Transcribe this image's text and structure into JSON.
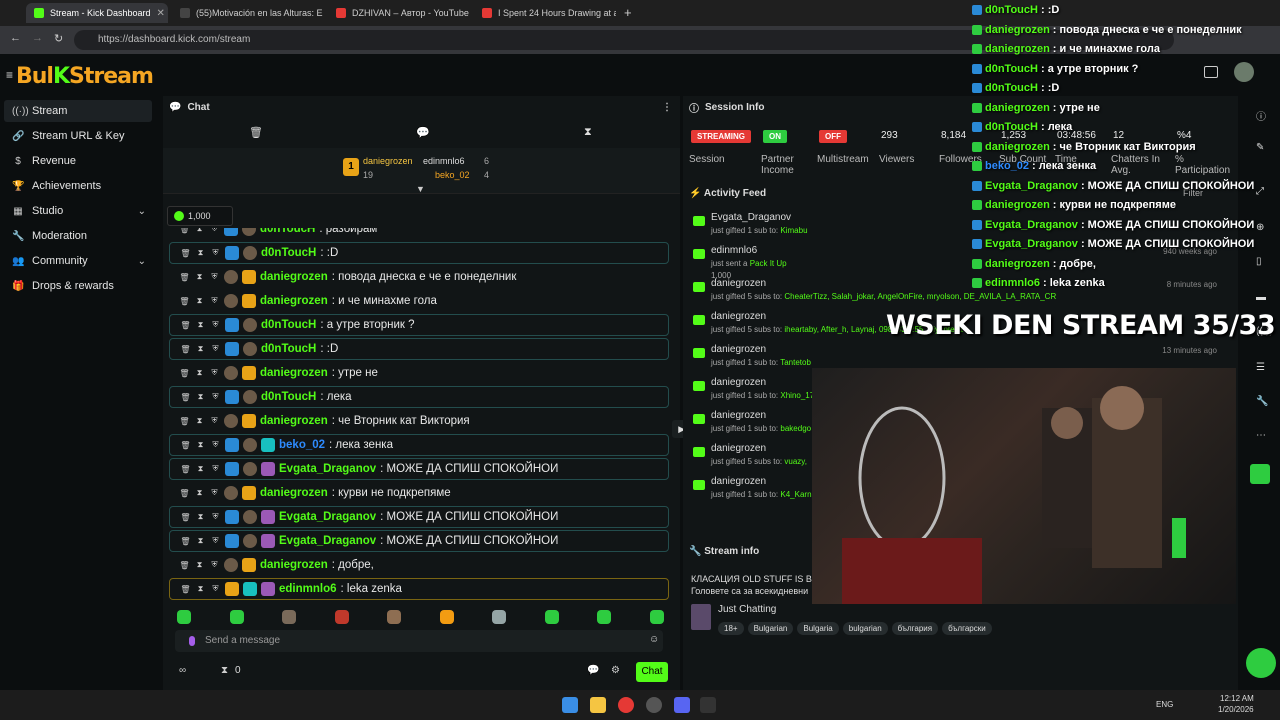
{
  "browser": {
    "tabs": [
      {
        "title": "Stream - Kick Dashboard",
        "color": "#53fc18"
      },
      {
        "title": "(55)Motivación en las Alturas: E",
        "color": "#444"
      },
      {
        "title": "DZHIVAN – Автор - YouTube",
        "color": "#e53935"
      },
      {
        "title": "I Spent 24 Hours Drawing at an",
        "color": "#e53935"
      }
    ],
    "url": "https://dashboard.kick.com/stream"
  },
  "sidebar": {
    "items": [
      {
        "label": "Stream",
        "icon": "((·))"
      },
      {
        "label": "Stream URL & Key",
        "icon": "🔗"
      },
      {
        "label": "Revenue",
        "icon": "$"
      },
      {
        "label": "Achievements",
        "icon": "🏆"
      },
      {
        "label": "Studio",
        "icon": "▦"
      },
      {
        "label": "Moderation",
        "icon": "🔧"
      },
      {
        "label": "Community",
        "icon": "👥"
      },
      {
        "label": "Drops & rewards",
        "icon": "🎁"
      }
    ]
  },
  "chat": {
    "title": "Chat",
    "leaderboard": [
      {
        "name": "daniegrozen",
        "count": "19"
      },
      {
        "name": "edinmnlo6",
        "count": "6"
      },
      {
        "name": "beko_02",
        "count": "4"
      }
    ],
    "gift_amount": "1,000",
    "messages": [
      {
        "user": "d0nToucH",
        "text": ": разбирам",
        "color": "#53fc18"
      },
      {
        "user": "d0nToucH",
        "text": ": :D",
        "color": "#53fc18"
      },
      {
        "user": "daniegrozen",
        "text": ": повода днеска е че е понеделник",
        "color": "#53fc18"
      },
      {
        "user": "daniegrozen",
        "text": ": и че минахме гола",
        "color": "#53fc18"
      },
      {
        "user": "d0nToucH",
        "text": ": а утре вторник ?",
        "color": "#53fc18"
      },
      {
        "user": "d0nToucH",
        "text": ": :D",
        "color": "#53fc18"
      },
      {
        "user": "daniegrozen",
        "text": ": утре не",
        "color": "#53fc18"
      },
      {
        "user": "d0nToucH",
        "text": ": лека",
        "color": "#53fc18"
      },
      {
        "user": "daniegrozen",
        "text": ": че Вторник кат Виктория",
        "color": "#53fc18"
      },
      {
        "user": "beko_02",
        "text": ": лека зенка",
        "color": "#2e8bff"
      },
      {
        "user": "Evgata_Draganov",
        "text": ": МОЖЕ ДА СПИШ СПОКОЙНОИ",
        "color": "#53fc18"
      },
      {
        "user": "daniegrozen",
        "text": ": курви не подкрепяме",
        "color": "#53fc18"
      },
      {
        "user": "Evgata_Draganov",
        "text": ": МОЖЕ ДА СПИШ СПОКОЙНОИ",
        "color": "#53fc18"
      },
      {
        "user": "Evgata_Draganov",
        "text": ": МОЖЕ ДА СПИШ СПОКОЙНОИ",
        "color": "#53fc18"
      },
      {
        "user": "daniegrozen",
        "text": ": добре,",
        "color": "#53fc18"
      },
      {
        "user": "edinmnlo6",
        "text": ": leka zenka",
        "color": "#53fc18"
      }
    ],
    "input_placeholder": "Send a message",
    "footer_count": "0",
    "send_label": "Chat"
  },
  "session": {
    "title": "Session Info",
    "stats": [
      {
        "value": "STREAMING",
        "label": "Session",
        "kind": "pill",
        "color": "#e53935"
      },
      {
        "value": "ON",
        "label": "Partner Income",
        "kind": "pill",
        "color": "#2ecc40"
      },
      {
        "value": "OFF",
        "label": "Multistream",
        "kind": "pill",
        "color": "#e53935"
      },
      {
        "value": "293",
        "label": "Viewers"
      },
      {
        "value": "8,184",
        "label": "Followers"
      },
      {
        "value": "1,253",
        "label": "Sub Count"
      },
      {
        "value": "03:48:56",
        "label": "Time"
      },
      {
        "value": "12",
        "label": "Chatters In Avg."
      },
      {
        "value": "%4",
        "label": "% Participation"
      }
    ],
    "activity_title": "Activity Feed",
    "filter_label": "Filter",
    "activity": [
      {
        "name": "Evgata_Draganov",
        "detail": "just gifted 1 sub to:",
        "targets": "Kimabu",
        "time": ""
      },
      {
        "name": "edinmnlo6",
        "detail": "just sent a",
        "targets": "Pack It Up",
        "time": "940 weeks ago",
        "amount": "1,000"
      },
      {
        "name": "daniegrozen",
        "detail": "just gifted 5 subs to:",
        "targets": "CheaterTizz, Salah_jokar, AngelOnFire, mryolson, DE_AVILA_LA_RATA_CR",
        "time": "8 minutes ago"
      },
      {
        "name": "daniegrozen",
        "detail": "just gifted 5 subs to:",
        "targets": "iheartaby, After_h, Laynaj, 0981833255, Kiyonte21",
        "time": ""
      },
      {
        "name": "daniegrozen",
        "detail": "just gifted 1 sub to:",
        "targets": "Tantetob",
        "time": "13 minutes ago"
      },
      {
        "name": "daniegrozen",
        "detail": "just gifted 1 sub to:",
        "targets": "Xhino_17",
        "time": ""
      },
      {
        "name": "daniegrozen",
        "detail": "just gifted 1 sub to:",
        "targets": "bakedgo",
        "time": ""
      },
      {
        "name": "daniegrozen",
        "detail": "just gifted 5 subs to:",
        "targets": "vuazy,",
        "time": ""
      },
      {
        "name": "daniegrozen",
        "detail": "just gifted 1 sub to:",
        "targets": "K4_Karn",
        "time": ""
      }
    ],
    "stream_info_title": "Stream info",
    "stream_title": "КЛАСАЦИЯ OLD STUFF IS B",
    "stream_sub": "Головете са за всекидневни",
    "category": "Just Chatting",
    "tags": [
      "18+",
      "Bulgarian",
      "Bulgaria",
      "bulgarian",
      "българия",
      "български"
    ]
  },
  "overlay": {
    "title": "WSEKI DEN STREAM 35/33",
    "messages": [
      {
        "user": "d0nToucH",
        "text": ": :D"
      },
      {
        "user": "daniegrozen",
        "text": ": повода днеска е че е понеделник"
      },
      {
        "user": "daniegrozen",
        "text": ": и че минахме гола"
      },
      {
        "user": "d0nToucH",
        "text": ": а утре вторник ?"
      },
      {
        "user": "d0nToucH",
        "text": ": :D"
      },
      {
        "user": "daniegrozen",
        "text": ": утре не"
      },
      {
        "user": "d0nToucH",
        "text": ": лека"
      },
      {
        "user": "daniegrozen",
        "text": ": че Вторник кат Виктория"
      },
      {
        "user": "beko_02",
        "text": ": лека зенка"
      },
      {
        "user": "Evgata_Draganov",
        "text": ": МОЖЕ ДА СПИШ СПОКОЙНОИ"
      },
      {
        "user": "daniegrozen",
        "text": ": курви не подкрепяме"
      },
      {
        "user": "Evgata_Draganov",
        "text": ": МОЖЕ ДА СПИШ СПОКОЙНОИ"
      },
      {
        "user": "Evgata_Draganov",
        "text": ": МОЖЕ ДА СПИШ СПОКОЙНОИ"
      },
      {
        "user": "daniegrozen",
        "text": ": добре,"
      },
      {
        "user": "edinmnlo6",
        "text": ": leka zenka"
      }
    ]
  },
  "taskbar": {
    "lang": "ENG",
    "time": "12:12 AM",
    "date": "1/20/2026"
  }
}
